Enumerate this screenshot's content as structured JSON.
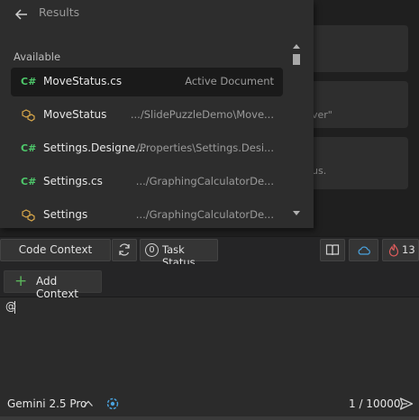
{
  "background": {
    "fragment_1": "ver\"",
    "fragment_2": "us."
  },
  "popup": {
    "back_label": "Results",
    "section_label": "Available",
    "items": [
      {
        "icon": "csharp-file-icon",
        "name": "MoveStatus.cs",
        "path": "Active Document",
        "selected": true
      },
      {
        "icon": "class-symbol-icon",
        "name": "MoveStatus",
        "path": ".../SlidePuzzleDemo\\Move...",
        "selected": false
      },
      {
        "icon": "csharp-file-icon",
        "name": "Settings.Designe...",
        "path": ".../Properties\\Settings.Desi...",
        "selected": false
      },
      {
        "icon": "csharp-file-icon",
        "name": "Settings.cs",
        "path": ".../GraphingCalculatorDe...",
        "selected": false
      },
      {
        "icon": "class-symbol-icon",
        "name": "Settings",
        "path": ".../GraphingCalculatorDe...",
        "selected": false
      }
    ]
  },
  "toolbar": {
    "code_context_label": "Code Context",
    "task_status_count": "0",
    "task_status_label": "Task Status",
    "flame_count": "13"
  },
  "context": {
    "add_context_label": "Add Context"
  },
  "input": {
    "value": "@"
  },
  "footer": {
    "model_label": "Gemini 2.5 Pro",
    "token_count": "1 / 10000"
  },
  "colors": {
    "accent_green": "#4ec96b",
    "icon_blue": "#4aa3df",
    "flame_red": "#e05c5c"
  }
}
